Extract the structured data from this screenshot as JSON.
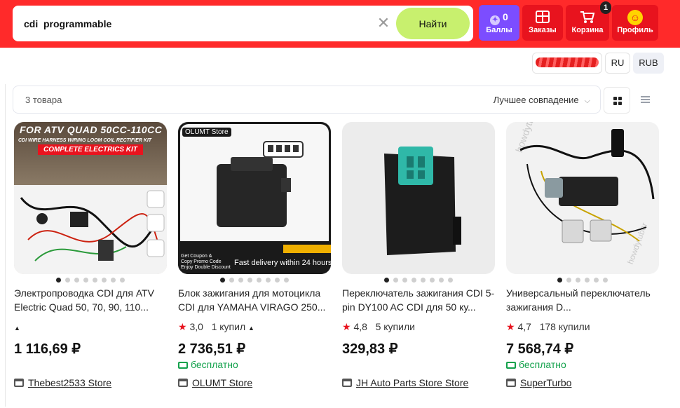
{
  "search": {
    "query": "cdi  programmable",
    "find_label": "Найти",
    "clear_glyph": "✕"
  },
  "header": {
    "points": {
      "count": "0",
      "label": "Баллы"
    },
    "orders_label": "Заказы",
    "cart_label": "Корзина",
    "cart_badge": "1",
    "profile_label": "Профиль"
  },
  "locale": {
    "language": "RU",
    "currency": "RUB"
  },
  "results": {
    "count_label": "3 товара",
    "sort_label": "Лучшее совпадение"
  },
  "products": [
    {
      "title": "Электропроводка CDI для ATV Electric Quad 50, 70, 90, 110...",
      "rating": "",
      "bought": "",
      "price": "1 116,69 ₽",
      "delivery": "",
      "store": "Thebest2533 Store",
      "image_banner": "FOR ATV QUAD 50CC-110CC",
      "image_sub": "CDI WIRE HARNESS WIRING LOOM COIL RECTIFIER KIT",
      "image_tag": "COMPLETE ELECTRICS KIT"
    },
    {
      "title": "Блок зажигания для мотоцикла CDI для YAMAHA VIRAGO 250...",
      "rating": "3,0",
      "bought": "1 купил",
      "price": "2 736,51 ₽",
      "delivery": "бесплатно",
      "store": "OLUMT Store",
      "image_brand": "OLUMT Store",
      "image_coupon_1": "Get Coupon &",
      "image_coupon_2": "Copy Promo Code",
      "image_coupon_3": "Enjoy Double Discount",
      "image_fast": "Fast delivery within 24 hours"
    },
    {
      "title": "Переключатель зажигания CDI 5-pin DY100 AC CDI для 50 ку...",
      "rating": "4,8",
      "bought": "5 купили",
      "price": "329,83 ₽",
      "delivery": "",
      "store": "JH Auto Parts Store Store"
    },
    {
      "title": "Универсальный переключатель зажигания D...",
      "rating": "4,7",
      "bought": "178 купили",
      "price": "7 568,74 ₽",
      "delivery": "бесплатно",
      "store": "SuperTurbo",
      "image_watermark_1": "howdytubor",
      "image_watermark_2": "howdytubor"
    }
  ],
  "colors": {
    "topbar": "#ff2a2a",
    "find_button": "#c8f06e",
    "points_button": "#7c4dff",
    "nav_button": "#e8131e",
    "free_delivery": "#12a14b",
    "rating_star": "#e8131e"
  },
  "icons": {
    "points": "coin-icon",
    "orders": "box-icon",
    "cart": "cart-icon",
    "profile": "smiley-icon",
    "grid_view": "grid-icon",
    "list_view": "list-icon",
    "delivery": "truck-icon",
    "store": "shop-icon",
    "rating": "star-icon"
  }
}
